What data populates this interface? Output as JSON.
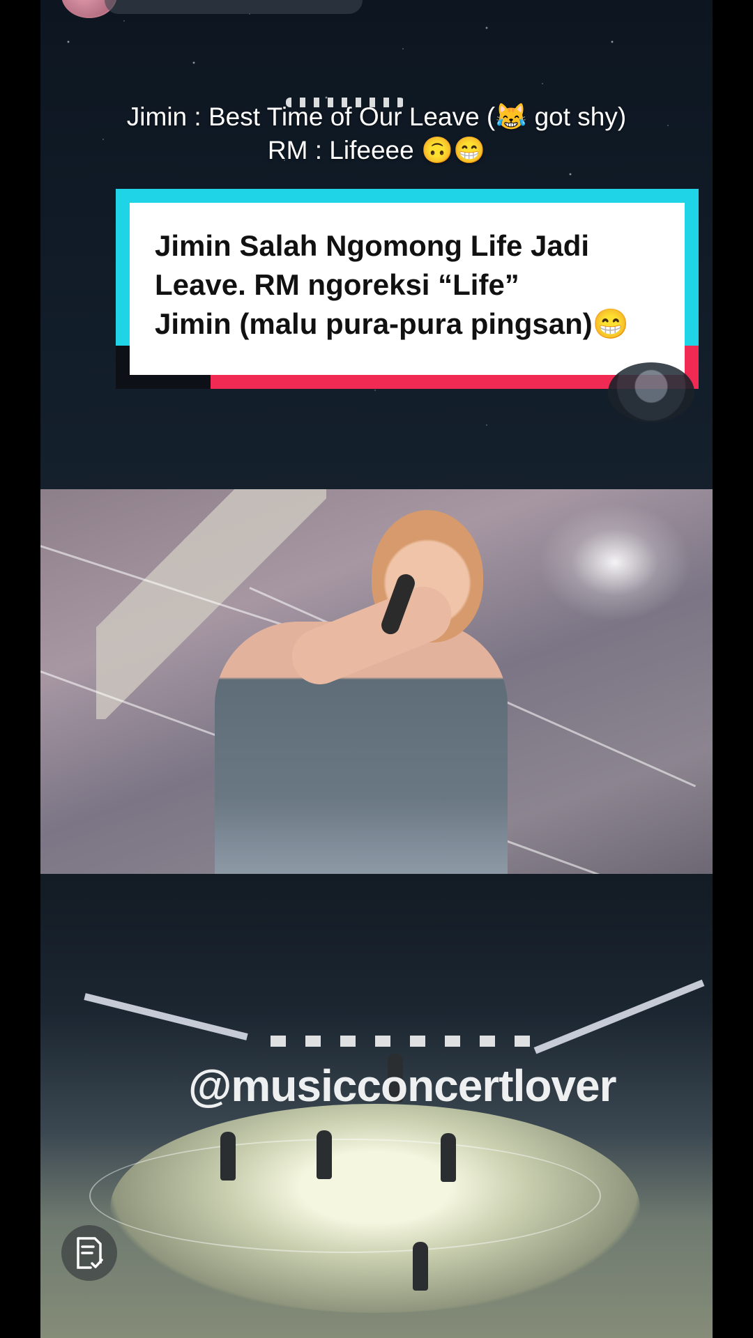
{
  "caption": {
    "line1": "Jimin : Best Time of Our Leave (😹 got shy)",
    "line2": "RM : Lifeeee 🙃😁"
  },
  "sticker": {
    "line1": "Jimin Salah Ngomong Life Jadi",
    "line2": "Leave. RM ngoreksi “Life”",
    "line3": "Jimin (malu pura-pura pingsan)😁",
    "colors": {
      "cyan": "#20d4e8",
      "red": "#f02a53",
      "card": "#ffffff"
    }
  },
  "watermark": {
    "text": "@musicconcertlover"
  },
  "icons": {
    "note": "note-check-icon",
    "avatar": "creator-avatar"
  }
}
